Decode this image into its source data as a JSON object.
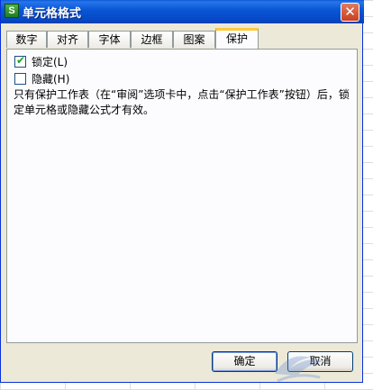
{
  "window": {
    "title": "单元格格式",
    "app_icon": "S",
    "close_glyph": "✕"
  },
  "tabs": [
    {
      "label": "数字",
      "active": false
    },
    {
      "label": "对齐",
      "active": false
    },
    {
      "label": "字体",
      "active": false
    },
    {
      "label": "边框",
      "active": false
    },
    {
      "label": "图案",
      "active": false
    },
    {
      "label": "保护",
      "active": true
    }
  ],
  "protection": {
    "locked": {
      "label": "锁定(L)",
      "checked": true
    },
    "hidden": {
      "label": "隐藏(H)",
      "checked": false
    },
    "note": "只有保护工作表（在“审阅”选项卡中，点击“保护工作表”按钮）后，锁定单元格或隐藏公式才有效。"
  },
  "buttons": {
    "ok": "确定",
    "cancel": "取消"
  },
  "colors": {
    "titlebar": "#0958d6",
    "active_tab_accent": "#ffc83c",
    "dialog_bg": "#ece9d8"
  }
}
